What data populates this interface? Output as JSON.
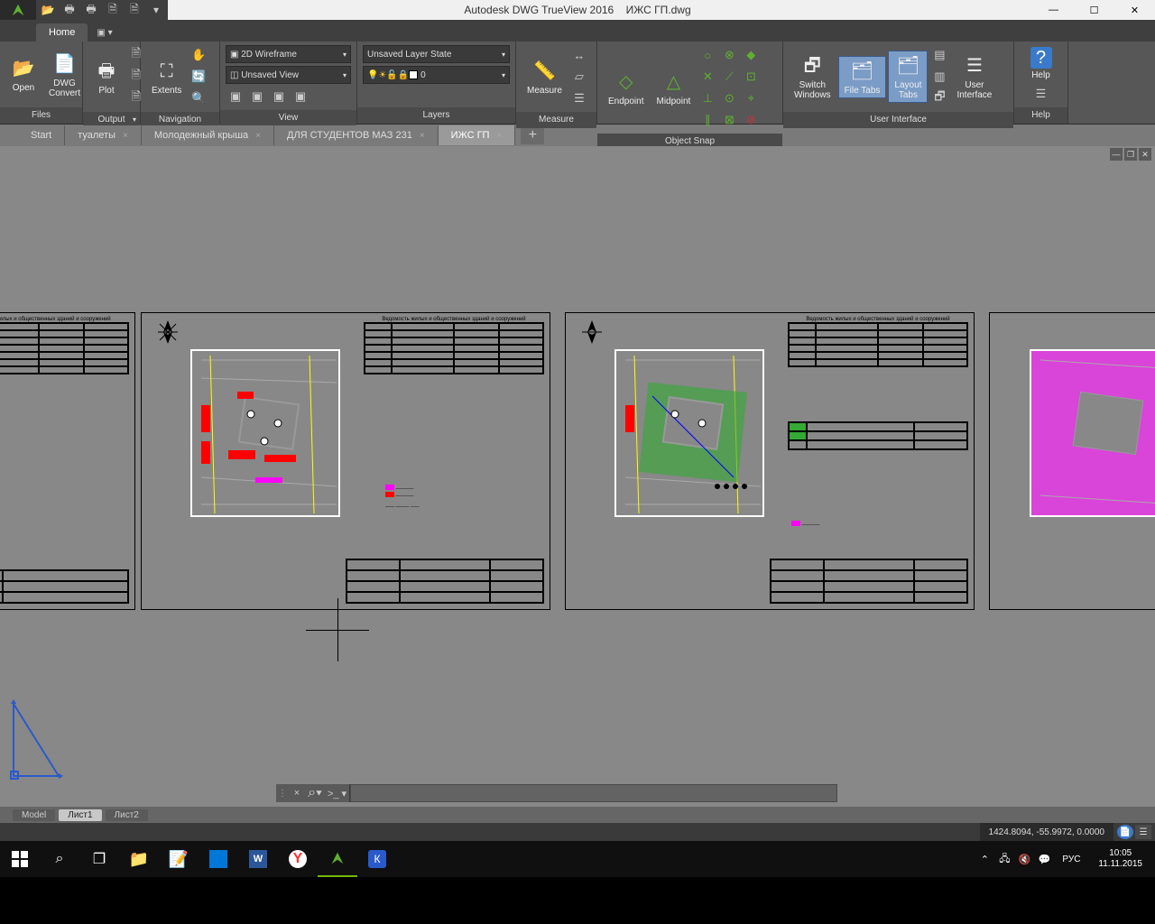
{
  "title": {
    "app": "Autodesk DWG TrueView 2016",
    "file": "ИЖС ГП.dwg"
  },
  "ribbon": {
    "tab": "Home",
    "panels": {
      "files": {
        "title": "Files",
        "open": "Open",
        "convert": "DWG\nConvert"
      },
      "output": {
        "title": "Output",
        "plot": "Plot"
      },
      "navigation": {
        "title": "Navigation",
        "extents": "Extents"
      },
      "view": {
        "title": "View",
        "style": "2D Wireframe",
        "saved": "Unsaved View"
      },
      "layers": {
        "title": "Layers",
        "state": "Unsaved Layer State",
        "current": "0"
      },
      "measure": {
        "title": "Measure",
        "btn": "Measure"
      },
      "osnap": {
        "title": "Object Snap",
        "endpoint": "Endpoint",
        "midpoint": "Midpoint"
      },
      "ui": {
        "title": "User Interface",
        "switch": "Switch\nWindows",
        "filetabs": "File Tabs",
        "layouttabs": "Layout\nTabs",
        "uiface": "User\nInterface"
      },
      "help": {
        "title": "Help",
        "btn": "Help"
      }
    }
  },
  "doc_tabs": [
    {
      "label": "Start",
      "active": false
    },
    {
      "label": "туалеты",
      "active": false
    },
    {
      "label": "Молодежный крыша",
      "active": false
    },
    {
      "label": "ДЛЯ СТУДЕНТОВ МАЗ 231",
      "active": false
    },
    {
      "label": "ИЖС ГП",
      "active": true
    }
  ],
  "layout_tabs": [
    {
      "label": "Model",
      "active": false
    },
    {
      "label": "Лист1",
      "active": true
    },
    {
      "label": "Лист2",
      "active": false
    }
  ],
  "status": {
    "coords": "1424.8094, -55.9972, 0.0000"
  },
  "taskbar": {
    "lang": "РУС",
    "time": "10:05",
    "date": "11.11.2015"
  },
  "sheets": {
    "schedule_title": "Ведомость жилых и общественных зданий и сооружений"
  }
}
